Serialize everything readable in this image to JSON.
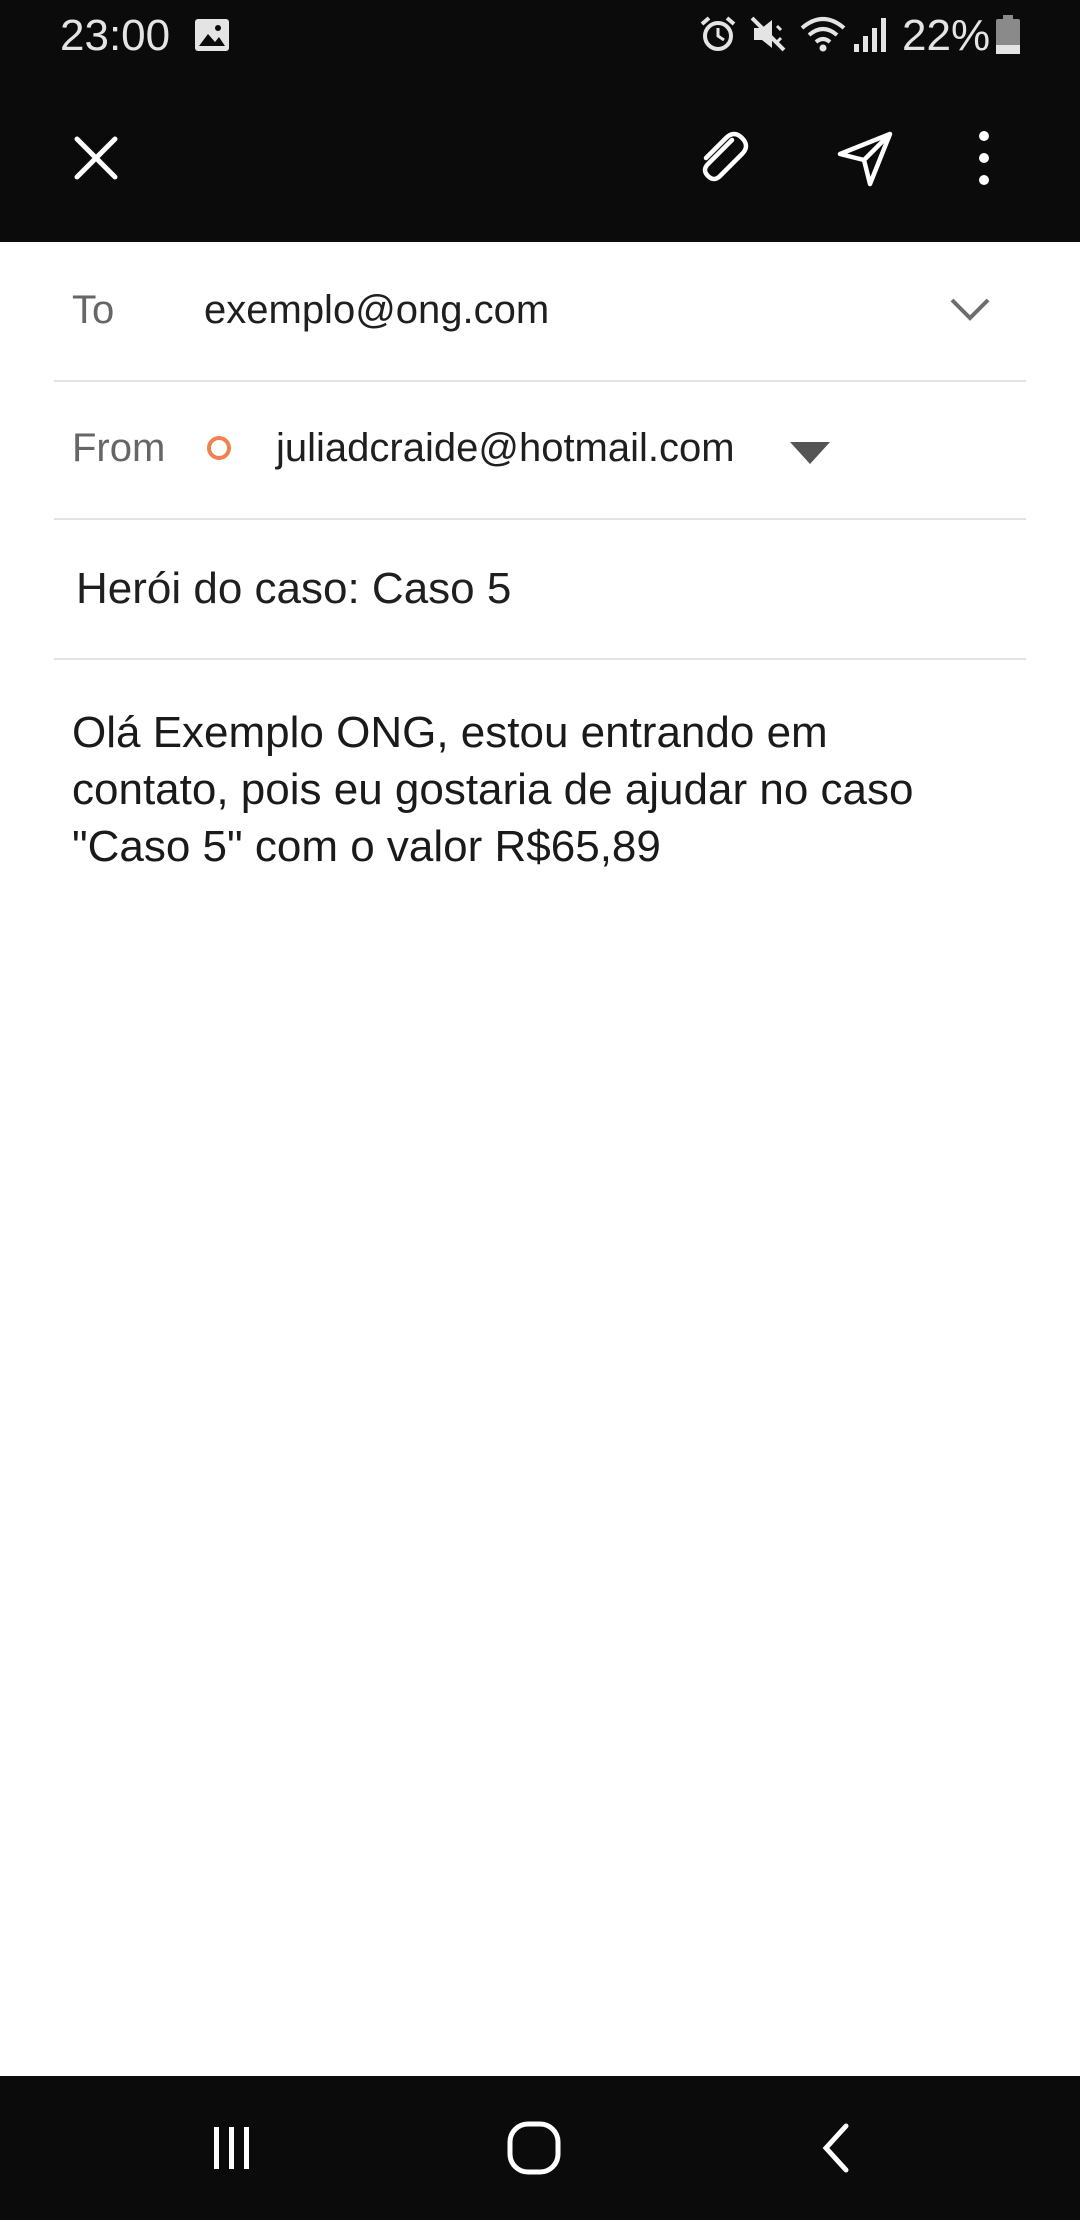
{
  "status_bar": {
    "time": "23:00",
    "battery": "22%",
    "icons": [
      "image-icon",
      "alarm-icon",
      "mute-icon",
      "wifi-icon",
      "signal-icon",
      "battery-icon"
    ]
  },
  "toolbar": {
    "icons": [
      "close-icon",
      "attach-icon",
      "send-icon",
      "more-vert-icon"
    ]
  },
  "compose": {
    "to_label": "To",
    "to_value": "exemplo@ong.com",
    "from_label": "From",
    "from_value": "juliadcraide@hotmail.com",
    "subject": "Herói do caso: Caso 5",
    "body": "Olá Exemplo ONG, estou entrando em\ncontato, pois eu gostaria de ajudar no caso\n\"Caso 5\" com o valor R$65,89"
  },
  "colors": {
    "bar_background": "#0b0b0b",
    "account_accent": "#f0824f",
    "divider": "#e3e3e3"
  },
  "nav_bar": {
    "icons": [
      "recents-icon",
      "home-icon",
      "back-icon"
    ]
  }
}
